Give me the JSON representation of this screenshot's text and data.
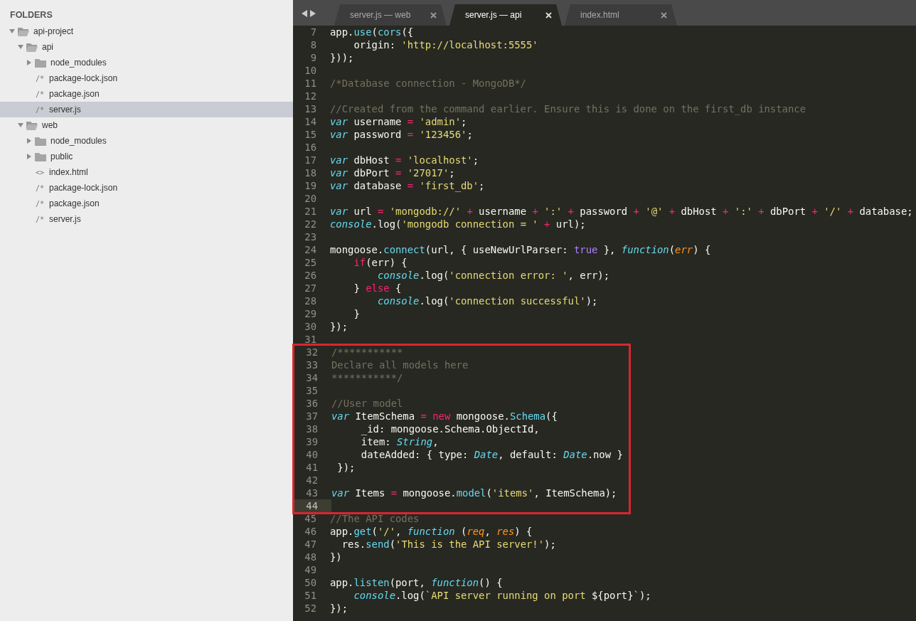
{
  "sidebar": {
    "heading": "FOLDERS",
    "tree": [
      {
        "kind": "folder",
        "label": "api-project",
        "expanded": true,
        "selected": false,
        "children": [
          {
            "kind": "folder",
            "label": "api",
            "expanded": true,
            "selected": false,
            "children": [
              {
                "kind": "folder",
                "label": "node_modules",
                "expanded": false,
                "selected": false
              },
              {
                "kind": "file",
                "icon": "/*",
                "label": "package-lock.json",
                "selected": false
              },
              {
                "kind": "file",
                "icon": "/*",
                "label": "package.json",
                "selected": false
              },
              {
                "kind": "file",
                "icon": "/*",
                "label": "server.js",
                "selected": true
              }
            ]
          },
          {
            "kind": "folder",
            "label": "web",
            "expanded": true,
            "selected": false,
            "children": [
              {
                "kind": "folder",
                "label": "node_modules",
                "expanded": false,
                "selected": false
              },
              {
                "kind": "folder",
                "label": "public",
                "expanded": false,
                "selected": false
              },
              {
                "kind": "file",
                "icon": "<>",
                "label": "index.html",
                "selected": false
              },
              {
                "kind": "file",
                "icon": "/*",
                "label": "package-lock.json",
                "selected": false
              },
              {
                "kind": "file",
                "icon": "/*",
                "label": "package.json",
                "selected": false
              },
              {
                "kind": "file",
                "icon": "/*",
                "label": "server.js",
                "selected": false
              }
            ]
          }
        ]
      }
    ]
  },
  "tabs": [
    {
      "label": "server.js — web",
      "selected": false
    },
    {
      "label": "server.js — api",
      "selected": true
    },
    {
      "label": "index.html",
      "selected": false
    }
  ],
  "editor": {
    "blocks": [
      {
        "highlighted": false,
        "lines": [
          {
            "number": "7",
            "current": false,
            "tokens": [
              {
                "kind": "plain",
                "text": "app."
              },
              {
                "kind": "call",
                "text": "use"
              },
              {
                "kind": "plain",
                "text": "("
              },
              {
                "kind": "call",
                "text": "cors"
              },
              {
                "kind": "plain",
                "text": "({"
              }
            ]
          },
          {
            "number": "8",
            "current": false,
            "tokens": [
              {
                "kind": "plain",
                "text": "    origin: "
              },
              {
                "kind": "string",
                "text": "'http://localhost:5555'"
              }
            ]
          },
          {
            "number": "9",
            "current": false,
            "tokens": [
              {
                "kind": "plain",
                "text": "}));"
              }
            ]
          },
          {
            "number": "10",
            "current": false
          },
          {
            "number": "11",
            "current": false,
            "tokens": [
              {
                "kind": "comment",
                "text": "/*Database connection - MongoDB*/"
              }
            ]
          },
          {
            "number": "12",
            "current": false
          },
          {
            "number": "13",
            "current": false,
            "tokens": [
              {
                "kind": "comment",
                "text": "//Created from the command earlier. Ensure this is done on the first_db instance"
              }
            ]
          },
          {
            "number": "14",
            "current": false,
            "tokens": [
              {
                "kind": "storage",
                "text": "var"
              },
              {
                "kind": "plain",
                "text": " username "
              },
              {
                "kind": "operator",
                "text": "= "
              },
              {
                "kind": "string",
                "text": "'admin'"
              },
              {
                "kind": "plain",
                "text": ";"
              }
            ]
          },
          {
            "number": "15",
            "current": false,
            "tokens": [
              {
                "kind": "storage",
                "text": "var"
              },
              {
                "kind": "plain",
                "text": " password "
              },
              {
                "kind": "operator",
                "text": "= "
              },
              {
                "kind": "string",
                "text": "'123456'"
              },
              {
                "kind": "plain",
                "text": ";"
              }
            ]
          },
          {
            "number": "16",
            "current": false
          },
          {
            "number": "17",
            "current": false,
            "tokens": [
              {
                "kind": "storage",
                "text": "var"
              },
              {
                "kind": "plain",
                "text": " dbHost "
              },
              {
                "kind": "operator",
                "text": "= "
              },
              {
                "kind": "string",
                "text": "'localhost'"
              },
              {
                "kind": "plain",
                "text": ";"
              }
            ]
          },
          {
            "number": "18",
            "current": false,
            "tokens": [
              {
                "kind": "storage",
                "text": "var"
              },
              {
                "kind": "plain",
                "text": " dbPort "
              },
              {
                "kind": "operator",
                "text": "= "
              },
              {
                "kind": "string",
                "text": "'27017'"
              },
              {
                "kind": "plain",
                "text": ";"
              }
            ]
          },
          {
            "number": "19",
            "current": false,
            "tokens": [
              {
                "kind": "storage",
                "text": "var"
              },
              {
                "kind": "plain",
                "text": " database "
              },
              {
                "kind": "operator",
                "text": "= "
              },
              {
                "kind": "string",
                "text": "'first_db'"
              },
              {
                "kind": "plain",
                "text": ";"
              }
            ]
          },
          {
            "number": "20",
            "current": false
          },
          {
            "number": "21",
            "current": false,
            "tokens": [
              {
                "kind": "storage",
                "text": "var"
              },
              {
                "kind": "plain",
                "text": " url "
              },
              {
                "kind": "operator",
                "text": "= "
              },
              {
                "kind": "string",
                "text": "'mongodb://'"
              },
              {
                "kind": "operator",
                "text": " + "
              },
              {
                "kind": "plain",
                "text": "username"
              },
              {
                "kind": "operator",
                "text": " + "
              },
              {
                "kind": "string",
                "text": "':'"
              },
              {
                "kind": "operator",
                "text": " + "
              },
              {
                "kind": "plain",
                "text": "password"
              },
              {
                "kind": "operator",
                "text": " + "
              },
              {
                "kind": "string",
                "text": "'@'"
              },
              {
                "kind": "operator",
                "text": " + "
              },
              {
                "kind": "plain",
                "text": "dbHost"
              },
              {
                "kind": "operator",
                "text": " + "
              },
              {
                "kind": "string",
                "text": "':'"
              },
              {
                "kind": "operator",
                "text": " + "
              },
              {
                "kind": "plain",
                "text": "dbPort"
              },
              {
                "kind": "operator",
                "text": " + "
              },
              {
                "kind": "string",
                "text": "'/'"
              },
              {
                "kind": "operator",
                "text": " + "
              },
              {
                "kind": "plain",
                "text": "database;"
              }
            ]
          },
          {
            "number": "22",
            "current": false,
            "tokens": [
              {
                "kind": "storage",
                "text": "console"
              },
              {
                "kind": "plain",
                "text": ".log("
              },
              {
                "kind": "string",
                "text": "'mongodb connection = '"
              },
              {
                "kind": "operator",
                "text": " + "
              },
              {
                "kind": "plain",
                "text": "url);"
              }
            ]
          },
          {
            "number": "23",
            "current": false
          },
          {
            "number": "24",
            "current": false,
            "tokens": [
              {
                "kind": "plain",
                "text": "mongoose."
              },
              {
                "kind": "call",
                "text": "connect"
              },
              {
                "kind": "plain",
                "text": "(url, { useNewUrlParser: "
              },
              {
                "kind": "constant",
                "text": "true"
              },
              {
                "kind": "plain",
                "text": " }, "
              },
              {
                "kind": "storage",
                "text": "function"
              },
              {
                "kind": "plain",
                "text": "("
              },
              {
                "kind": "param",
                "text": "err"
              },
              {
                "kind": "plain",
                "text": ") {"
              }
            ]
          },
          {
            "number": "25",
            "current": false,
            "tokens": [
              {
                "kind": "operator",
                "text": "    if"
              },
              {
                "kind": "plain",
                "text": "(err) {"
              }
            ]
          },
          {
            "number": "26",
            "current": false,
            "tokens": [
              {
                "kind": "storage",
                "text": "        console"
              },
              {
                "kind": "plain",
                "text": ".log("
              },
              {
                "kind": "string",
                "text": "'connection error: '"
              },
              {
                "kind": "plain",
                "text": ", err);"
              }
            ]
          },
          {
            "number": "27",
            "current": false,
            "tokens": [
              {
                "kind": "plain",
                "text": "    } "
              },
              {
                "kind": "operator",
                "text": "else"
              },
              {
                "kind": "plain",
                "text": " {"
              }
            ]
          },
          {
            "number": "28",
            "current": false,
            "tokens": [
              {
                "kind": "storage",
                "text": "        console"
              },
              {
                "kind": "plain",
                "text": ".log("
              },
              {
                "kind": "string",
                "text": "'connection successful'"
              },
              {
                "kind": "plain",
                "text": ");"
              }
            ]
          },
          {
            "number": "29",
            "current": false,
            "tokens": [
              {
                "kind": "plain",
                "text": "    }"
              }
            ]
          },
          {
            "number": "30",
            "current": false,
            "tokens": [
              {
                "kind": "plain",
                "text": "});"
              }
            ]
          },
          {
            "number": "31",
            "current": false
          }
        ]
      },
      {
        "highlighted": true,
        "lines": [
          {
            "number": "32",
            "current": false,
            "tokens": [
              {
                "kind": "comment",
                "text": "/***********"
              }
            ]
          },
          {
            "number": "33",
            "current": false,
            "tokens": [
              {
                "kind": "comment",
                "text": "Declare all models here"
              }
            ]
          },
          {
            "number": "34",
            "current": false,
            "tokens": [
              {
                "kind": "comment",
                "text": "***********/"
              }
            ]
          },
          {
            "number": "35",
            "current": false
          },
          {
            "number": "36",
            "current": false,
            "tokens": [
              {
                "kind": "comment",
                "text": "//User model"
              }
            ]
          },
          {
            "number": "37",
            "current": false,
            "tokens": [
              {
                "kind": "storage",
                "text": "var"
              },
              {
                "kind": "plain",
                "text": " ItemSchema "
              },
              {
                "kind": "operator",
                "text": "= new"
              },
              {
                "kind": "plain",
                "text": " mongoose."
              },
              {
                "kind": "call",
                "text": "Schema"
              },
              {
                "kind": "plain",
                "text": "({"
              }
            ]
          },
          {
            "number": "38",
            "current": false,
            "tokens": [
              {
                "kind": "plain",
                "text": "     _id: mongoose.Schema.ObjectId,"
              }
            ]
          },
          {
            "number": "39",
            "current": false,
            "tokens": [
              {
                "kind": "plain",
                "text": "     item: "
              },
              {
                "kind": "storage",
                "text": "String"
              },
              {
                "kind": "plain",
                "text": ","
              }
            ]
          },
          {
            "number": "40",
            "current": false,
            "tokens": [
              {
                "kind": "plain",
                "text": "     dateAdded: { type: "
              },
              {
                "kind": "storage",
                "text": "Date"
              },
              {
                "kind": "plain",
                "text": ", default: "
              },
              {
                "kind": "storage",
                "text": "Date"
              },
              {
                "kind": "plain",
                "text": ".now }"
              }
            ]
          },
          {
            "number": "41",
            "current": false,
            "tokens": [
              {
                "kind": "plain",
                "text": " });"
              }
            ]
          },
          {
            "number": "42",
            "current": false
          },
          {
            "number": "43",
            "current": false,
            "tokens": [
              {
                "kind": "storage",
                "text": "var"
              },
              {
                "kind": "plain",
                "text": " Items "
              },
              {
                "kind": "operator",
                "text": "= "
              },
              {
                "kind": "plain",
                "text": "mongoose."
              },
              {
                "kind": "call",
                "text": "model"
              },
              {
                "kind": "plain",
                "text": "("
              },
              {
                "kind": "string",
                "text": "'items'"
              },
              {
                "kind": "plain",
                "text": ", ItemSchema);"
              }
            ]
          },
          {
            "number": "44",
            "current": true
          }
        ]
      },
      {
        "highlighted": false,
        "lines": [
          {
            "number": "45",
            "current": false,
            "tokens": [
              {
                "kind": "comment",
                "text": "//The API codes"
              }
            ]
          },
          {
            "number": "46",
            "current": false,
            "tokens": [
              {
                "kind": "plain",
                "text": "app."
              },
              {
                "kind": "call",
                "text": "get"
              },
              {
                "kind": "plain",
                "text": "("
              },
              {
                "kind": "string",
                "text": "'/'"
              },
              {
                "kind": "plain",
                "text": ", "
              },
              {
                "kind": "storage",
                "text": "function"
              },
              {
                "kind": "plain",
                "text": " ("
              },
              {
                "kind": "param",
                "text": "req"
              },
              {
                "kind": "plain",
                "text": ", "
              },
              {
                "kind": "param",
                "text": "res"
              },
              {
                "kind": "plain",
                "text": ") {"
              }
            ]
          },
          {
            "number": "47",
            "current": false,
            "tokens": [
              {
                "kind": "plain",
                "text": "  res."
              },
              {
                "kind": "call",
                "text": "send"
              },
              {
                "kind": "plain",
                "text": "("
              },
              {
                "kind": "string",
                "text": "'This is the API server!'"
              },
              {
                "kind": "plain",
                "text": ");"
              }
            ]
          },
          {
            "number": "48",
            "current": false,
            "tokens": [
              {
                "kind": "plain",
                "text": "})"
              }
            ]
          },
          {
            "number": "49",
            "current": false
          },
          {
            "number": "50",
            "current": false,
            "tokens": [
              {
                "kind": "plain",
                "text": "app."
              },
              {
                "kind": "call",
                "text": "listen"
              },
              {
                "kind": "plain",
                "text": "(port, "
              },
              {
                "kind": "storage",
                "text": "function"
              },
              {
                "kind": "plain",
                "text": "() {"
              }
            ]
          },
          {
            "number": "51",
            "current": false,
            "tokens": [
              {
                "kind": "storage",
                "text": "    console"
              },
              {
                "kind": "plain",
                "text": ".log("
              },
              {
                "kind": "string",
                "text": "`API server running on port "
              },
              {
                "kind": "plain",
                "text": "${port}"
              },
              {
                "kind": "string",
                "text": "`"
              },
              {
                "kind": "plain",
                "text": ");"
              }
            ]
          },
          {
            "number": "52",
            "current": false,
            "tokens": [
              {
                "kind": "plain",
                "text": "});"
              }
            ]
          }
        ]
      }
    ]
  }
}
